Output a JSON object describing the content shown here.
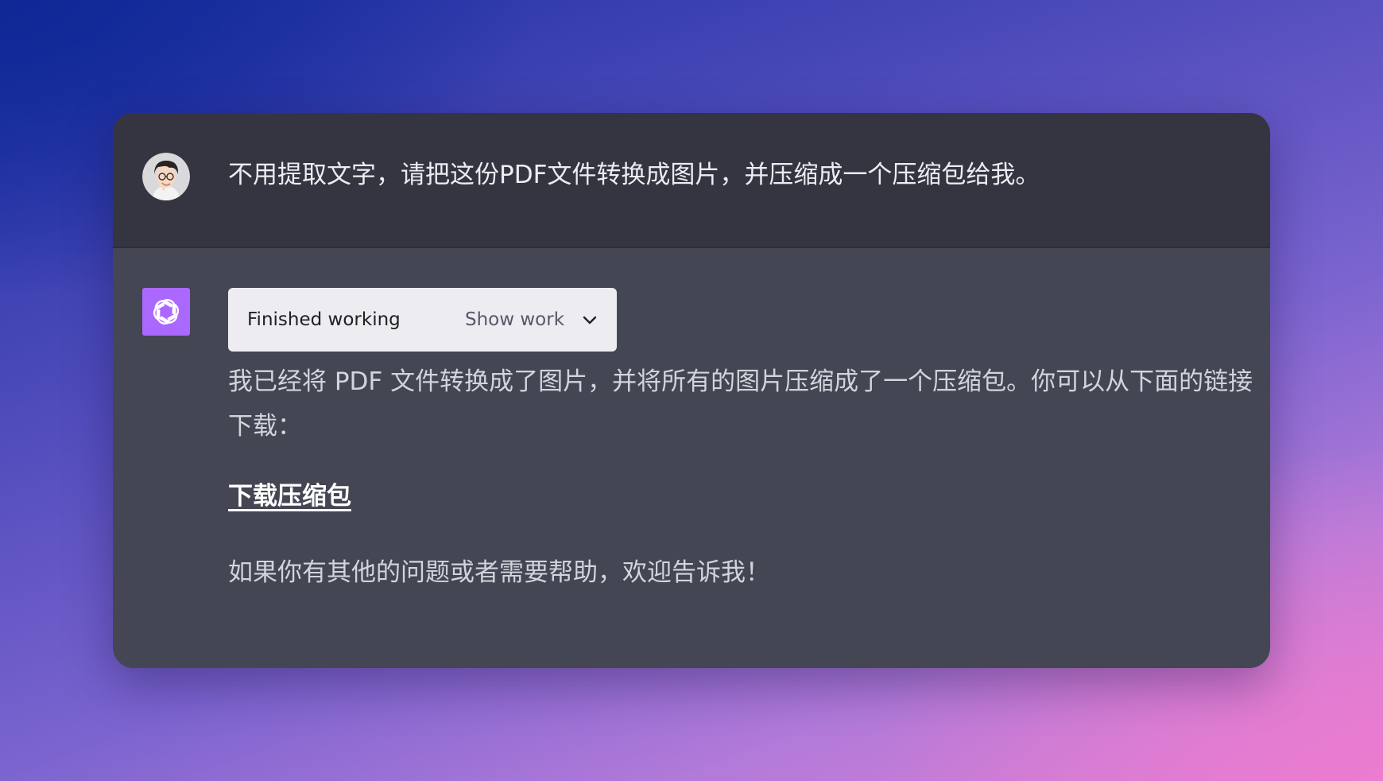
{
  "user_message": {
    "avatar": "user-avatar",
    "text": "不用提取文字，请把这份PDF文件转换成图片，并压缩成一个压缩包给我。"
  },
  "assistant_message": {
    "avatar": "openai-logo-icon",
    "avatar_color": "#ab68ff",
    "status": {
      "label": "Finished working",
      "toggle_label": "Show work",
      "toggle_icon": "chevron-down-icon"
    },
    "paragraph_1": "我已经将 PDF 文件转换成了图片，并将所有的图片压缩成了一个压缩包。你可以从下面的链接下载：",
    "download_link": "下载压缩包",
    "paragraph_2": "如果你有其他的问题或者需要帮助，欢迎告诉我！"
  },
  "colors": {
    "user_row_bg": "#343541",
    "assistant_row_bg": "#444654",
    "status_box_bg": "#ececf1",
    "text_primary": "#ececf1",
    "text_secondary": "#d1d5db"
  }
}
